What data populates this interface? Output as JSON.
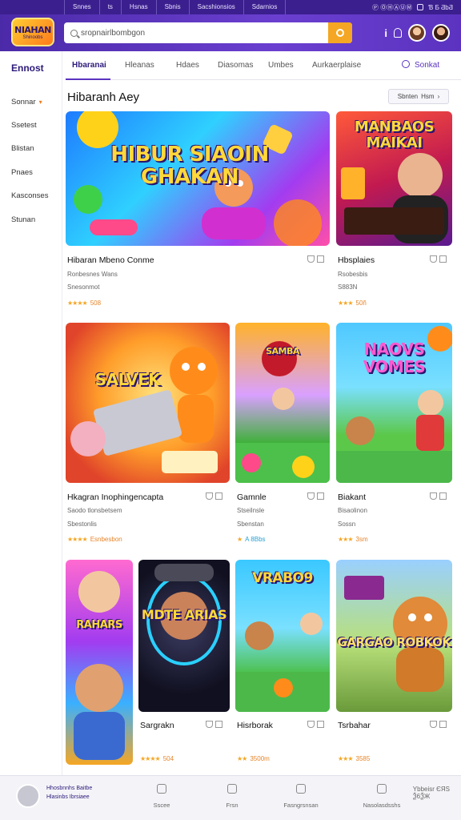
{
  "topbar": {
    "links": [
      "Snnes",
      "ts",
      "Hsnas",
      "Sbnis",
      "Sacshionsios",
      "Sdarnios"
    ],
    "right_text": "Ⓟ ⓄⒽⒶⓊⓂ",
    "right_label": "Ɓ Ƃ ƋbƋ"
  },
  "header": {
    "logo_line1": "NIAHAN",
    "logo_line2": "Shinoobs",
    "search_placeholder": "sropnairlbombgon",
    "info_glyph": "i"
  },
  "sidebar": {
    "title": "Ennost",
    "items": [
      "Sonnar",
      "Ssetest",
      "Blistan",
      "Pnaes",
      "Kasconses",
      "Stunan"
    ]
  },
  "tabs": {
    "items": [
      "Hbaranai",
      "Hleanas",
      "Hdaes",
      "Diasomas",
      "Umbes",
      "Aurkaerplaise"
    ],
    "sort_label": "Sonkat"
  },
  "section": {
    "title": "Hibaranh Aey",
    "chip_label": "Sbnten",
    "chip_suffix": "Hsm"
  },
  "cards": [
    {
      "caption": "HIBUR SIAOIN GHAKAN",
      "title": "Hibaran Mbeno Conme",
      "meta1": "Ronbesnes Wans",
      "meta2": "Snesonmot",
      "stars": "★★★★",
      "rating": "508"
    },
    {
      "caption": "MANBAOS MAIKAI",
      "title": "Hbsplaies",
      "meta1": "Rsobesbis",
      "meta2": "S883N",
      "stars": "★★★",
      "rating": "50ñ"
    },
    {
      "caption": "SALVEK",
      "title": "Hkagran Inophingencapta",
      "meta1": "Saodo tlonsbetsem",
      "meta2": "Sbestonlis",
      "stars": "★★★★",
      "rating": "Esnbesbon"
    },
    {
      "caption": "SAMBA",
      "title": "Gamnle",
      "meta1": "Stseilnsle",
      "meta2": "Sbenstan",
      "stars": "★",
      "rating": "A 8Bbs"
    },
    {
      "caption": "NAOVS VOMES",
      "title": "Biakant",
      "meta1": "Bisaolinon",
      "meta2": "Sossn",
      "stars": "★★★",
      "rating": "3sm"
    },
    {
      "caption": "RAHARS",
      "title": "",
      "meta1": "",
      "meta2": "",
      "stars": "",
      "rating": ""
    },
    {
      "caption": "MDTE ARIAS",
      "title": "Sargrakn",
      "meta1": "",
      "meta2": "",
      "stars": "★★★★",
      "rating": "504"
    },
    {
      "caption": "VRABO9",
      "title": "Hisrborak",
      "meta1": "",
      "meta2": "",
      "stars": "★★",
      "rating": "3500m"
    },
    {
      "caption": "GARGAO ROBKOK",
      "title": "Tsrbahar",
      "meta1": "",
      "meta2": "",
      "stars": "★★★",
      "rating": "3585"
    }
  ],
  "bottombar": {
    "text_line1": "Hhosbnnhs Baitbe",
    "text_line2": "Hlasinbs Ibrsiaee",
    "nav": [
      "Sscee",
      "Frsn",
      "Fasngrsnsan",
      "Nasolasdsshs"
    ],
    "right_text": "Ybbeisr ЄЯS",
    "right_text2": "Ѯ6ѮЖ"
  },
  "colors": {
    "brand": "#4b2aa8",
    "accent": "#f5a623",
    "link": "#5b33c0"
  }
}
